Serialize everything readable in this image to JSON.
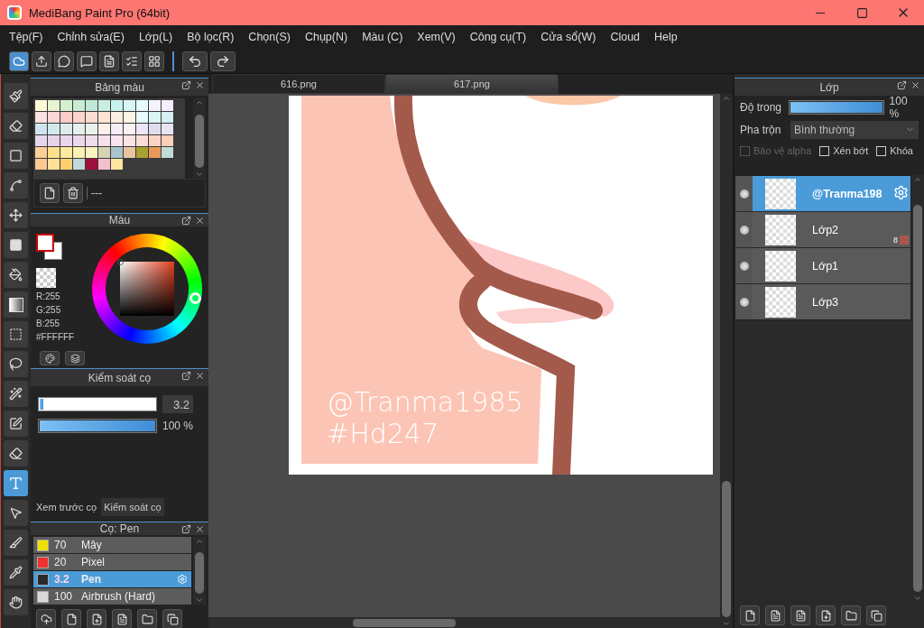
{
  "window": {
    "title": "MediBang Paint Pro (64bit)"
  },
  "menu": [
    "Tệp(F)",
    "Chỉnh sửa(E)",
    "Lớp(L)",
    "Bộ lọc(R)",
    "Chọn(S)",
    "Chụp(N)",
    "Màu (C)",
    "Xem(V)",
    "Công cụ(T)",
    "Cửa sổ(W)",
    "Cloud",
    "Help"
  ],
  "tools": [
    {
      "kind": "brush",
      "selected": false
    },
    {
      "kind": "eraser",
      "selected": false
    },
    {
      "kind": "shape",
      "selected": false
    },
    {
      "kind": "curve",
      "selected": false
    },
    {
      "kind": "move",
      "selected": false
    },
    {
      "kind": "fill",
      "selected": false
    },
    {
      "kind": "bucket",
      "selected": false
    },
    {
      "kind": "gradient",
      "selected": false
    },
    {
      "kind": "select",
      "selected": false
    },
    {
      "kind": "lasso",
      "selected": false
    },
    {
      "kind": "wand",
      "selected": false
    },
    {
      "kind": "select_pen",
      "selected": false
    },
    {
      "kind": "select_eraser",
      "selected": false
    },
    {
      "kind": "text",
      "selected": true
    },
    {
      "kind": "object",
      "selected": false
    },
    {
      "kind": "knife",
      "selected": false
    },
    {
      "kind": "eyedropper",
      "selected": false
    },
    {
      "kind": "hand",
      "selected": false
    }
  ],
  "palette_panel": {
    "title": "Bảng màu",
    "palette_name": "---",
    "swatches": [
      {
        "color": "#fffbd6"
      },
      {
        "color": "#e6f4d0"
      },
      {
        "color": "#d4efd0"
      },
      {
        "color": "#c8ecd4"
      },
      {
        "color": "#bfe9d6"
      },
      {
        "color": "#c8eee0"
      },
      {
        "color": "#c8f0ef"
      },
      {
        "color": "#d8f6f8"
      },
      {
        "color": "#e6fbfd"
      },
      {
        "color": "#f4f4fd"
      },
      {
        "color": "#f6eefb"
      },
      {
        "color": "#fde0e0"
      },
      {
        "color": "#fdd6d6"
      },
      {
        "color": "#fcccc8"
      },
      {
        "color": "#fcd4cc"
      },
      {
        "color": "#fddcd0"
      },
      {
        "color": "#fde4d6"
      },
      {
        "color": "#fdece0"
      },
      {
        "color": "#fdf4e6"
      },
      {
        "color": "#e6fbfb"
      },
      {
        "color": "#dcf5f6"
      },
      {
        "color": "#d4eff0"
      },
      {
        "color": "#cfe4f0"
      },
      {
        "color": "#d2e8ec"
      },
      {
        "color": "#dfeaea"
      },
      {
        "color": "#e6f0ec"
      },
      {
        "color": "#ecf2ea"
      },
      {
        "color": "#fdf0ea"
      },
      {
        "color": "#f6eef6"
      },
      {
        "color": "#fdf0f0"
      },
      {
        "color": "#ece6f6"
      },
      {
        "color": "#e2dcef"
      },
      {
        "color": "#e8e4f4"
      },
      {
        "color": "#e6d6ec"
      },
      {
        "color": "#e8d4e8"
      },
      {
        "color": "#ead6ec"
      },
      {
        "color": "#ecd8ec"
      },
      {
        "color": "#f0dcea"
      },
      {
        "color": "#f6e0ea"
      },
      {
        "color": "#fae4ee"
      },
      {
        "color": "#fce4e6"
      },
      {
        "color": "#fcdcd6"
      },
      {
        "color": "#fcd4c4"
      },
      {
        "color": "#fcd0b8"
      },
      {
        "color": "#fccf96"
      },
      {
        "color": "#fde08a"
      },
      {
        "color": "#fde9a0"
      },
      {
        "color": "#fdf0b0"
      },
      {
        "color": "#fdf4c4"
      },
      {
        "color": "#d8d2b4"
      },
      {
        "color": "#aac4cc"
      },
      {
        "color": "#e8c4a0"
      },
      {
        "color": "#a8a030"
      },
      {
        "color": "#e89858"
      },
      {
        "color": "#c0dcd8"
      },
      {
        "color": "#fcc894"
      },
      {
        "color": "#fde096"
      },
      {
        "color": "#fcd070"
      },
      {
        "color": "#c0d8dc"
      },
      {
        "color": "#a0103c"
      },
      {
        "color": "#f4c0d0"
      },
      {
        "color": "#fde6a0"
      }
    ]
  },
  "color_panel": {
    "title": "Màu",
    "rgb": [
      "R:255",
      "G:255",
      "B:255"
    ],
    "hex": "#FFFFFF"
  },
  "brush_control": {
    "title": "Kiểm soát cọ",
    "size": {
      "level": 0.03,
      "reading": "3.2"
    },
    "opacity": {
      "level": 1,
      "reading": "100 %"
    }
  },
  "panel_tabs": [
    {
      "label": "Xem trước cọ",
      "selected": false
    },
    {
      "label": "Kiểm soát cọ",
      "selected": true
    }
  ],
  "brush_panel": {
    "title": "Cọ: Pen",
    "brushes": [
      {
        "size": "70",
        "name": "Mây",
        "color": "#f0e000",
        "selected": false
      },
      {
        "size": "20",
        "name": "Pixel",
        "color": "#f03030",
        "selected": false
      },
      {
        "size": "3.2",
        "name": "Pen",
        "color": "#2a2a2a",
        "selected": true
      },
      {
        "size": "100",
        "name": "Airbrush (Hard)",
        "color": "#d8d8d8",
        "selected": false
      }
    ]
  },
  "documents": [
    {
      "label": "616.png",
      "selected": false
    },
    {
      "label": "617.png",
      "selected": true
    }
  ],
  "canvas": {
    "texts": [
      "@Tranma1985",
      "#Hd247"
    ]
  },
  "layer_panel": {
    "title": "Lớp",
    "opacity": {
      "label": "Độ trong",
      "level": 1,
      "reading": "100 %"
    },
    "blend": {
      "label": "Pha trộn",
      "value": "Bình thường"
    },
    "options": [
      {
        "label": "Bảo vệ alpha",
        "checked": false,
        "disabled": true
      },
      {
        "label": "Xén bớt",
        "checked": false,
        "disabled": false
      },
      {
        "label": "Khóa",
        "checked": false,
        "disabled": false
      }
    ],
    "layers": [
      {
        "name": "@Tranma198",
        "selected": true
      },
      {
        "name": "Lớp2",
        "selected": false,
        "badge": "8",
        "color": "#a8584a"
      },
      {
        "name": "Lớp1",
        "selected": false
      },
      {
        "name": "Lớp3",
        "selected": false
      }
    ]
  }
}
